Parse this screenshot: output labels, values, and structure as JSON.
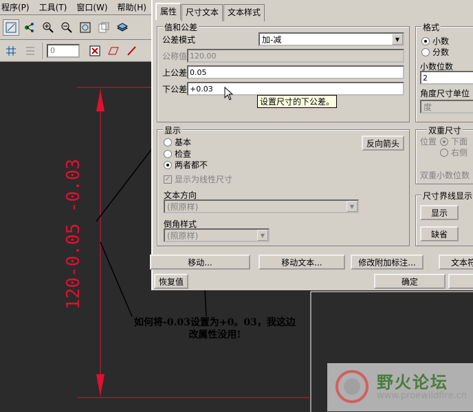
{
  "menubar": {
    "items": [
      {
        "label": "程序(P)"
      },
      {
        "label": "工具(T)"
      },
      {
        "label": "窗口(W)"
      },
      {
        "label": "帮助(H)"
      },
      {
        "label": "帮"
      }
    ]
  },
  "toolbar": {
    "spin_value": "0"
  },
  "dialog": {
    "tabs": [
      {
        "label": "属性"
      },
      {
        "label": "尺寸文本"
      },
      {
        "label": "文本样式"
      }
    ],
    "value_tolerance": {
      "group_title": "值和公差",
      "tolerance_mode_label": "公差模式",
      "tolerance_mode_value": "加-减",
      "nominal_label": "公称值",
      "nominal_value": "120.00",
      "upper_label": "上公差",
      "upper_value": "0.05",
      "lower_label": "下公差",
      "lower_value": "+0.03"
    },
    "tooltip": "设置尺寸的下公差。",
    "format": {
      "group_title": "格式",
      "decimal_label": "小数",
      "fraction_label": "分数",
      "decimal_places_label": "小数位数",
      "decimal_places_value": "2",
      "angle_unit_label": "角度尺寸单位",
      "angle_unit_value": "度"
    },
    "display": {
      "group_title": "显示",
      "basic_label": "基本",
      "inspect_label": "检查",
      "neither_label": "两者都不",
      "linear_label": "显示为线性尺寸",
      "flip_arrows_label": "反向箭头",
      "text_direction_label": "文本方向",
      "text_direction_value": "(照原样)",
      "chamfer_label": "倒角样式",
      "chamfer_value": "(照原样)"
    },
    "dual": {
      "group_title": "双重尺寸",
      "position_label": "位置",
      "below_label": "下面",
      "right_label": "右侧",
      "dual_decimal_label": "双重小数位数"
    },
    "ext_lines": {
      "group_title": "尺寸界线显示",
      "show_label": "显示",
      "default_label": "缺省"
    },
    "buttons": {
      "move": "移动...",
      "move_text": "移动文本...",
      "modify_attached": "修改附加标注...",
      "text_sym": "文本符",
      "restore": "恢复值",
      "ok": "确定"
    }
  },
  "cad": {
    "dimension_text": "120-0.05 -0.03"
  },
  "annotation": {
    "line1": "如何将-0.03设置为+0。03，我这边",
    "line2": "改属性没用!"
  },
  "watermark": {
    "name": "野火论坛",
    "url": "www.proewildfire.cn"
  }
}
